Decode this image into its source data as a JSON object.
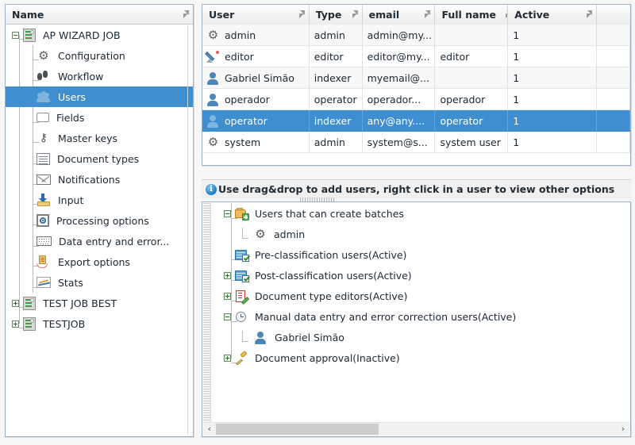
{
  "left_panel": {
    "header": {
      "label": "Name",
      "sort_icon": "sort-icon"
    },
    "tree": [
      {
        "label": "AP  WIZARD JOB",
        "icon": "server-icon",
        "indent": 0,
        "expander": "minus",
        "selected": false
      },
      {
        "label": "Configuration",
        "icon": "gears-icon",
        "indent": 1,
        "expander": "none",
        "selected": false
      },
      {
        "label": "Workflow",
        "icon": "footsteps-icon",
        "indent": 1,
        "expander": "none",
        "selected": false
      },
      {
        "label": "Users",
        "icon": "users-group-icon",
        "indent": 1,
        "expander": "none",
        "selected": true
      },
      {
        "label": "Fields",
        "icon": "field-box-icon",
        "indent": 1,
        "expander": "none",
        "selected": false
      },
      {
        "label": "Master keys",
        "icon": "key-icon",
        "indent": 1,
        "expander": "none",
        "selected": false
      },
      {
        "label": "Document types",
        "icon": "document-types-icon",
        "indent": 1,
        "expander": "none",
        "selected": false
      },
      {
        "label": "Notifications",
        "icon": "envelope-icon",
        "indent": 1,
        "expander": "none",
        "selected": false
      },
      {
        "label": "Input",
        "icon": "input-tray-icon",
        "indent": 1,
        "expander": "none",
        "selected": false
      },
      {
        "label": "Processing options",
        "icon": "target-icon",
        "indent": 1,
        "expander": "none",
        "selected": false
      },
      {
        "label": "Data entry and error...",
        "icon": "keyboard-icon",
        "indent": 1,
        "expander": "none",
        "selected": false
      },
      {
        "label": "Export options",
        "icon": "export-icon",
        "indent": 1,
        "expander": "none",
        "selected": false
      },
      {
        "label": "Stats",
        "icon": "stats-chart-icon",
        "indent": 1,
        "expander": "none",
        "selected": false
      },
      {
        "label": "TEST JOB BEST",
        "icon": "server-icon",
        "indent": 0,
        "expander": "plus",
        "selected": false
      },
      {
        "label": "TESTJOB",
        "icon": "server-icon",
        "indent": 0,
        "expander": "plus",
        "selected": false
      }
    ]
  },
  "users_table": {
    "columns": [
      {
        "label": "User",
        "width": 135
      },
      {
        "label": "Type",
        "width": 67
      },
      {
        "label": "email",
        "width": 92
      },
      {
        "label": "Full name",
        "width": 92
      },
      {
        "label": "Active",
        "width": 112
      },
      {
        "label": "",
        "width": 42
      }
    ],
    "rows": [
      {
        "icon": "gears-icon",
        "user": "admin",
        "type": "admin",
        "email": "admin@my...",
        "full_name": "",
        "active": "1",
        "selected": false
      },
      {
        "icon": "pencil-icon",
        "user": "editor",
        "type": "editor",
        "email": "editor@my...",
        "full_name": "editor",
        "active": "1",
        "selected": false
      },
      {
        "icon": "person-icon",
        "user": "Gabriel Simão",
        "type": "indexer",
        "email": "myemail@...",
        "full_name": "",
        "active": "1",
        "selected": false
      },
      {
        "icon": "person-icon",
        "user": "operador",
        "type": "operator",
        "email": "operador...",
        "full_name": "operador",
        "active": "1",
        "selected": false
      },
      {
        "icon": "person-icon",
        "user": "operator",
        "type": "indexer",
        "email": "any@any....",
        "full_name": "operator",
        "active": "1",
        "selected": true
      },
      {
        "icon": "gears-icon",
        "user": "system",
        "type": "admin",
        "email": "system@s...",
        "full_name": "system user",
        "active": "1",
        "selected": false
      }
    ]
  },
  "info_bar": {
    "icon": "info-icon",
    "message": "Use drag&drop to add users, right click in a user to view other options"
  },
  "roles_tree": [
    {
      "label": "Users that can create batches",
      "icon": "batch-add-icon",
      "indent": 0,
      "expander": "minus"
    },
    {
      "label": "admin",
      "icon": "gears-icon",
      "indent": 1,
      "expander": "none"
    },
    {
      "label": "Pre-classification users(Active)",
      "icon": "classification-icon",
      "indent": 0,
      "expander": "none"
    },
    {
      "label": "Post-classification users(Active)",
      "icon": "classification-icon",
      "indent": 0,
      "expander": "plus"
    },
    {
      "label": "Document type editors(Active)",
      "icon": "doc-type-editor-icon",
      "indent": 0,
      "expander": "plus"
    },
    {
      "label": "Manual data entry and error correction users(Active)",
      "icon": "clock-icon",
      "indent": 0,
      "expander": "minus"
    },
    {
      "label": "Gabriel Simão",
      "icon": "person-icon",
      "indent": 1,
      "expander": "none"
    },
    {
      "label": "Document approval(Inactive)",
      "icon": "stamp-icon",
      "indent": 0,
      "expander": "plus"
    }
  ],
  "scrollbar": {
    "left_arrow": "‹",
    "right_arrow": "›"
  },
  "colors": {
    "selection": "#3f8fd0",
    "panel_border": "#9db0c4",
    "header_text": "#222a33",
    "info_blue": "#1b7fc7"
  }
}
